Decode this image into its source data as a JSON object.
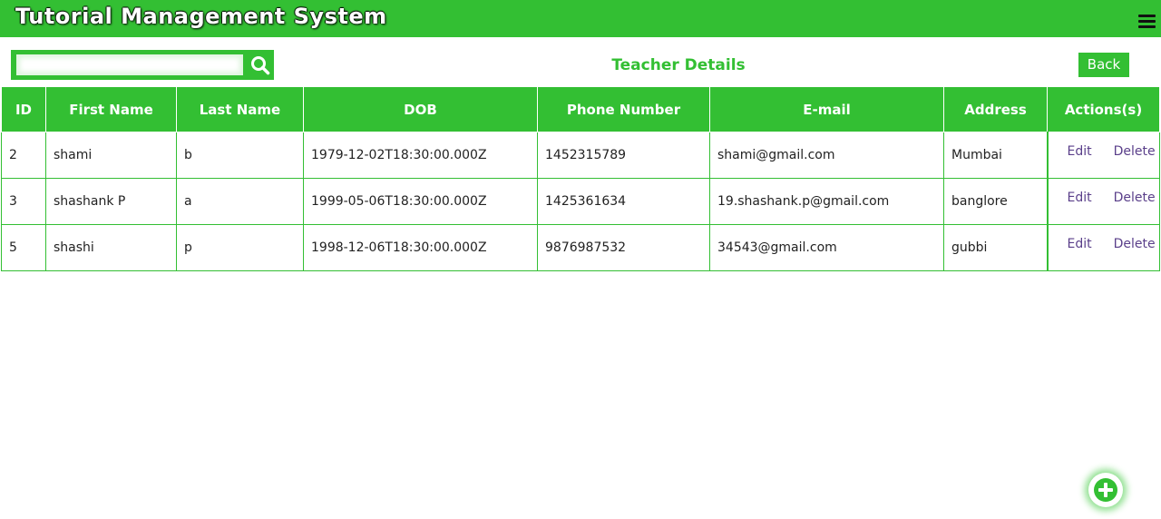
{
  "app": {
    "title": "Tutorial Management System"
  },
  "search": {
    "placeholder": "",
    "value": ""
  },
  "page": {
    "title": "Teacher Details",
    "back_label": "Back"
  },
  "table": {
    "headers": [
      "ID",
      "First Name",
      "Last Name",
      "DOB",
      "Phone Number",
      "E-mail",
      "Address",
      "Actions(s)"
    ],
    "rows": [
      {
        "id": "2",
        "first_name": "shami",
        "last_name": "b",
        "dob": "1979-12-02T18:30:00.000Z",
        "phone": "1452315789",
        "email": "shami@gmail.com",
        "address": "Mumbai"
      },
      {
        "id": "3",
        "first_name": "shashank P",
        "last_name": "a",
        "dob": "1999-05-06T18:30:00.000Z",
        "phone": "1425361634",
        "email": "19.shashank.p@gmail.com",
        "address": "banglore"
      },
      {
        "id": "5",
        "first_name": "shashi",
        "last_name": "p",
        "dob": "1998-12-06T18:30:00.000Z",
        "phone": "9876987532",
        "email": "34543@gmail.com",
        "address": "gubbi"
      }
    ],
    "edit_label": "Edit",
    "delete_label": "Delete"
  },
  "icons": {
    "menu": "hamburger-menu-icon",
    "search": "search-icon",
    "add": "plus-circle-icon"
  },
  "colors": {
    "accent": "#33bf33",
    "link": "#5a3f8a",
    "title_shadow": "#000000"
  }
}
